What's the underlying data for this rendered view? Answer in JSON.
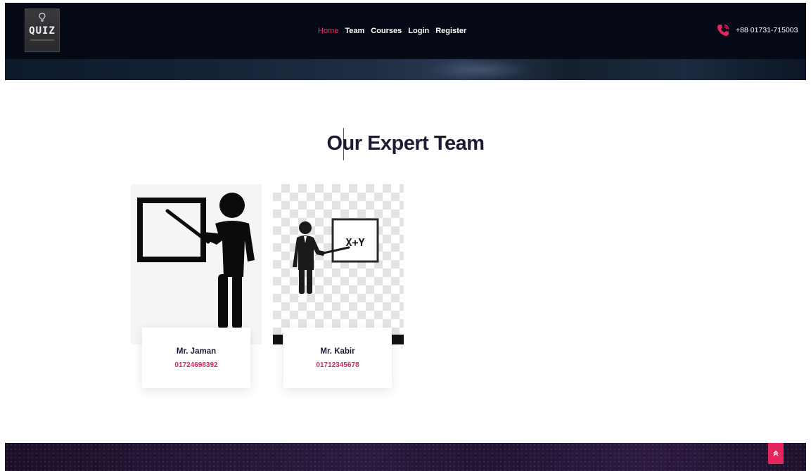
{
  "header": {
    "logo_text": "QUIZ",
    "nav": [
      {
        "label": "Home",
        "active": true
      },
      {
        "label": "Team",
        "active": false
      },
      {
        "label": "Courses",
        "active": false
      },
      {
        "label": "Login",
        "active": false
      },
      {
        "label": "Register",
        "active": false
      }
    ],
    "phone": "+88 01731-715003"
  },
  "section": {
    "title": "Our Expert Team"
  },
  "team": [
    {
      "name": "Mr. Jaman",
      "phone": "01724698392"
    },
    {
      "name": "Mr. Kabir",
      "phone": "01712345678",
      "board_text": "X+Y"
    }
  ],
  "colors": {
    "header_bg": "#060a16",
    "accent": "#e7316a",
    "title": "#1c1b34",
    "phone_accent": "#cc2a5c",
    "footer_bg": "#231534"
  },
  "icons": {
    "logo": "quiz-logo-icon",
    "phone": "phone-ringing-icon",
    "scroll_top": "double-chevron-up-icon"
  }
}
